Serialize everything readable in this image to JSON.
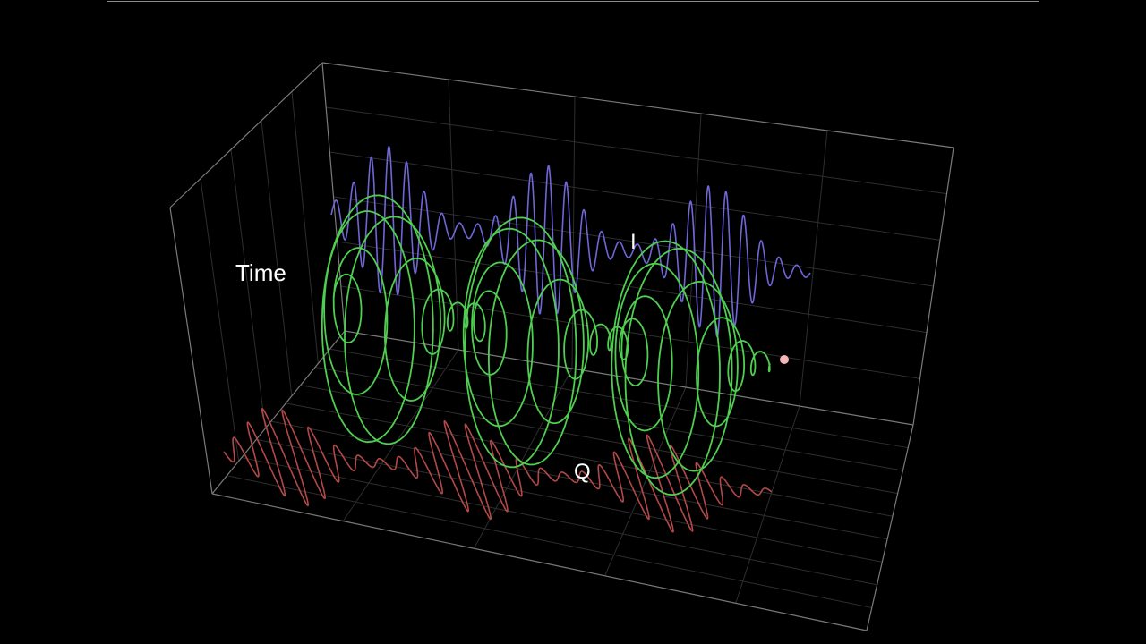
{
  "labels": {
    "time": "Time",
    "i_axis": "I",
    "q_axis": "Q"
  },
  "colors": {
    "background": "#000000",
    "box_edge": "#7a7a7a",
    "grid": "#2e2e2e",
    "i_wave": "#6f66d8",
    "q_wave": "#b34848",
    "helix": "#4fcf4f",
    "marker": "#f6b6b6"
  },
  "signal": {
    "description_pulses": 3,
    "carrier_cycles_per_pulse": 9
  }
}
